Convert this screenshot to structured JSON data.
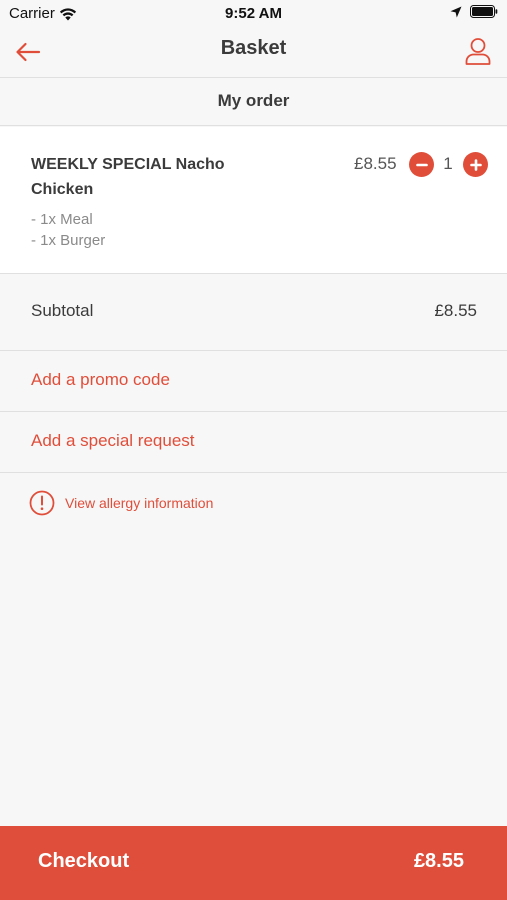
{
  "status_bar": {
    "carrier": "Carrier",
    "time": "9:52 AM"
  },
  "nav": {
    "title": "Basket",
    "back_icon": "arrow-left-icon",
    "profile_icon": "user-icon"
  },
  "section": {
    "title": "My order"
  },
  "order": {
    "items": [
      {
        "name": "WEEKLY SPECIAL Nacho Chicken",
        "price": "£8.55",
        "quantity": "1",
        "options": [
          "- 1x Meal",
          "- 1x Burger"
        ]
      }
    ]
  },
  "summary": {
    "subtotal_label": "Subtotal",
    "subtotal_value": "£8.55"
  },
  "actions": {
    "promo_label": "Add a promo code",
    "special_request_label": "Add a special request",
    "allergy_label": "View allergy information"
  },
  "checkout": {
    "label": "Checkout",
    "total": "£8.55"
  },
  "colors": {
    "accent": "#e04e3a",
    "checkout_bg": "#df4e3a",
    "background": "#f7f7f7"
  }
}
